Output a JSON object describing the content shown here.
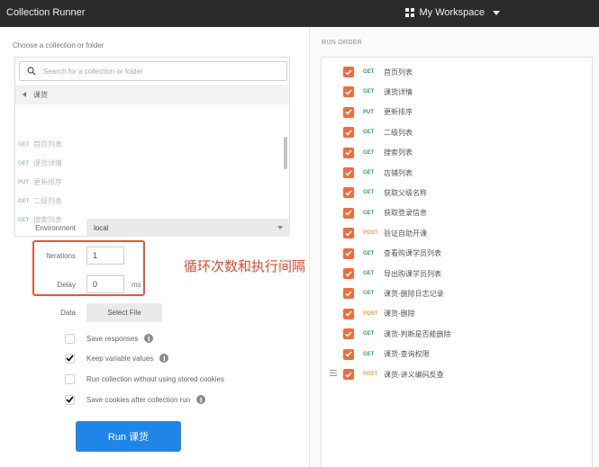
{
  "titlebar": {
    "app_title": "Collection Runner",
    "workspace": "My Workspace"
  },
  "left": {
    "choose_label": "Choose a collection or folder",
    "search_placeholder": "Search for a collection or folder",
    "breadcrumb": "课货",
    "requests": [
      {
        "method": "GET",
        "name": "首页列表"
      },
      {
        "method": "GET",
        "name": "课货详情"
      },
      {
        "method": "PUT",
        "name": "更新排序"
      },
      {
        "method": "GET",
        "name": "二级列表"
      },
      {
        "method": "GET",
        "name": "搜索列表"
      }
    ],
    "environment_label": "Environment",
    "environment_value": "local",
    "iterations_label": "Iterations",
    "iterations_value": "1",
    "delay_label": "Delay",
    "delay_value": "0",
    "delay_unit": "ms",
    "annotation": "循环次数和执行间隔",
    "data_label": "Data",
    "select_file": "Select File",
    "options": [
      {
        "label": "Save responses",
        "checked": false,
        "info": true
      },
      {
        "label": "Keep variable values",
        "checked": true,
        "info": true
      },
      {
        "label": "Run collection without using stored cookies",
        "checked": false,
        "info": false
      },
      {
        "label": "Save cookies after collection run",
        "checked": true,
        "info": true
      }
    ],
    "run_button": "Run 课货"
  },
  "run_order": {
    "label": "RUN ORDER",
    "items": [
      {
        "method": "GET",
        "name": "首页列表"
      },
      {
        "method": "GET",
        "name": "课货详情"
      },
      {
        "method": "PUT",
        "name": "更新排序"
      },
      {
        "method": "GET",
        "name": "二级列表"
      },
      {
        "method": "GET",
        "name": "搜索列表"
      },
      {
        "method": "GET",
        "name": "店铺列表"
      },
      {
        "method": "GET",
        "name": "获取父级名称"
      },
      {
        "method": "GET",
        "name": "获取登录信息"
      },
      {
        "method": "POST",
        "name": "验证自助开课"
      },
      {
        "method": "GET",
        "name": "查看购课学员列表"
      },
      {
        "method": "GET",
        "name": "导出购课学员列表"
      },
      {
        "method": "GET",
        "name": "课货-删除日志记录"
      },
      {
        "method": "POST",
        "name": "课货-删除"
      },
      {
        "method": "GET",
        "name": "课货-判断是否能删除"
      },
      {
        "method": "GET",
        "name": "课货-查询权限"
      },
      {
        "method": "POST",
        "name": "课货-讲义编码反查"
      }
    ]
  },
  "colors": {
    "titlebar_bg": "#2b2b2b",
    "accent_blue": "#1f86e7",
    "checkbox_orange": "#f26b3a",
    "get": "#36a65e",
    "put": "#3e83c9",
    "post": "#f0a040",
    "annotation_red": "#e04a2f"
  }
}
